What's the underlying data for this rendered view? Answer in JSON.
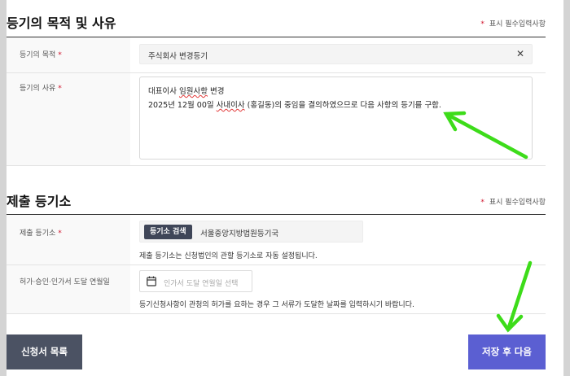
{
  "purpose_section": {
    "title": "등기의 목적 및 사유",
    "required_note": "표시 필수입력사항",
    "purpose_label": "등기의 목적",
    "purpose_value": "주식회사 변경등기",
    "reason_label": "등기의 사유",
    "reason_line1_prefix": "대표이사 ",
    "reason_line1_wavy": "임원사항",
    "reason_line1_suffix": " 변경",
    "reason_line2_prefix": "2025년 12월 00일 ",
    "reason_line2_wavy": "사내이사",
    "reason_line2_suffix": " (홍길동)의 중임을 결의하였으므로 다음 사항의 등기를 구함."
  },
  "registry_section": {
    "title": "제출 등기소",
    "required_note": "표시 필수입력사항",
    "registry_label": "제출 등기소",
    "search_button": "등기소 검색",
    "registry_value": "서울중앙지방법원등기국",
    "registry_helper": "제출 등기소는 신청법인의 관할 등기소로 자동 설정됩니다.",
    "date_label": "허가·승인·인가서 도달 연월일",
    "date_placeholder": "인가서 도달 연월일 선택",
    "date_helper": "등기신청사항이 관청의 허가를 요하는 경우 그 서류가 도달한 날짜를 입력하시기 바랍니다."
  },
  "footer": {
    "list_button": "신청서 목록",
    "next_button": "저장 후 다음"
  },
  "colors": {
    "required_star": "#d0142c",
    "primary_button": "#5b5fd2",
    "secondary_button": "#4b5263",
    "annotation_arrow": "#3ddc1a"
  }
}
